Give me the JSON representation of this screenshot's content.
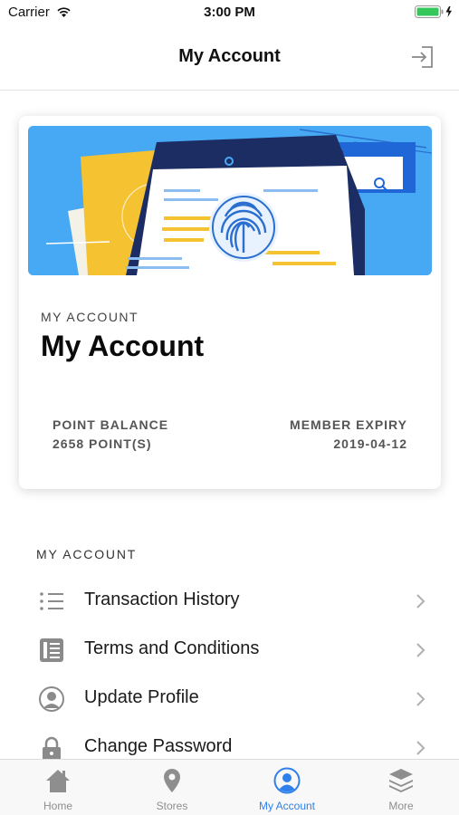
{
  "status_bar": {
    "carrier": "Carrier",
    "time": "3:00 PM"
  },
  "nav": {
    "title": "My Account",
    "logout_icon": "logout-icon"
  },
  "account_card": {
    "kicker": "MY ACCOUNT",
    "title": "My Account",
    "point_balance_label": "POINT BALANCE",
    "point_balance_value": "2658 POINT(S)",
    "member_expiry_label": "MEMBER EXPIRY",
    "member_expiry_value": "2019-04-12"
  },
  "menu": {
    "section_title": "MY ACCOUNT",
    "items": [
      {
        "label": "Transaction History",
        "icon": "list-icon"
      },
      {
        "label": "Terms and Conditions",
        "icon": "document-icon"
      },
      {
        "label": "Update Profile",
        "icon": "profile-icon"
      },
      {
        "label": "Change Password",
        "icon": "lock-icon"
      }
    ]
  },
  "tab_bar": {
    "tabs": [
      {
        "label": "Home",
        "icon": "home-icon",
        "active": false
      },
      {
        "label": "Stores",
        "icon": "location-pin-icon",
        "active": false
      },
      {
        "label": "My Account",
        "icon": "person-icon",
        "active": true
      },
      {
        "label": "More",
        "icon": "layers-icon",
        "active": false
      }
    ]
  },
  "colors": {
    "accent": "#2f80ed",
    "banner_blue": "#47a9f4",
    "inactive_tab": "#8e8e8e"
  }
}
